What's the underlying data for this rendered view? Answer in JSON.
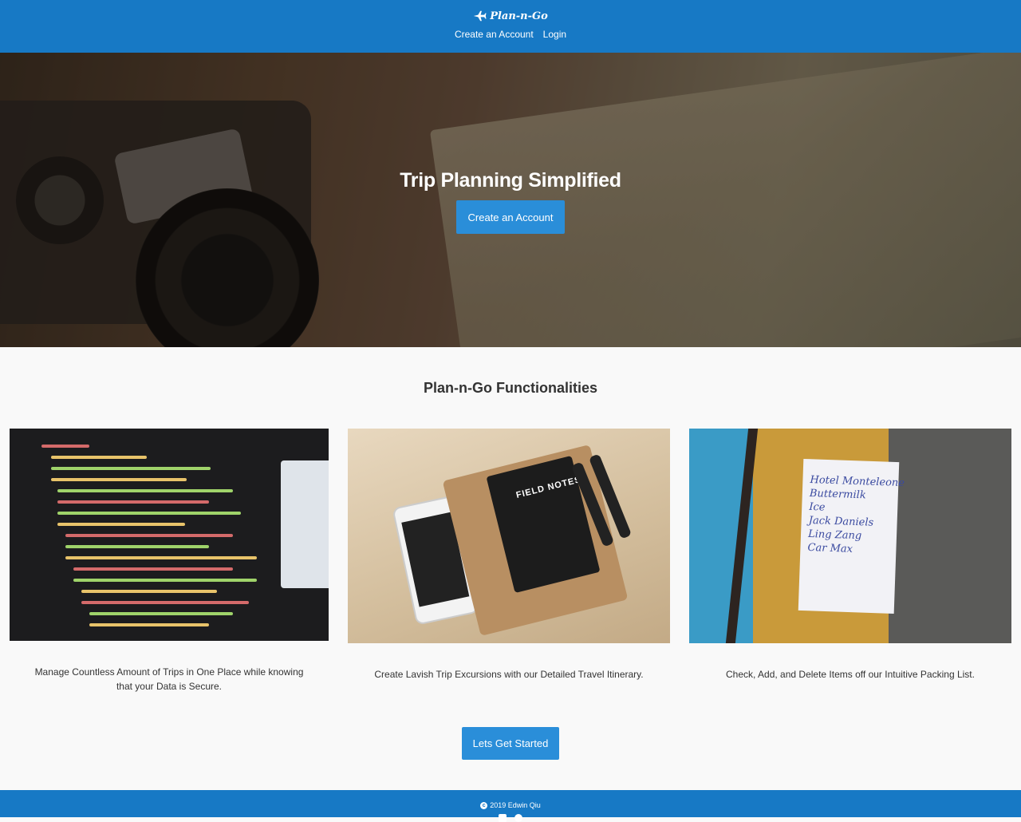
{
  "navbar": {
    "brand": "Plan-n-Go",
    "brand_icon": "airplane-icon",
    "links": [
      {
        "label": "Create an Account"
      },
      {
        "label": "Login"
      }
    ],
    "color": "#1779c5"
  },
  "hero": {
    "title": "Trip Planning Simplified",
    "cta_label": "Create an Account",
    "cta_color": "#2a8ed9"
  },
  "features": {
    "title": "Plan-n-Go Functionalities",
    "cards": [
      {
        "image": "code-editor-photo",
        "text": "Manage Countless Amount of Trips in One Place while knowing that your Data is Secure."
      },
      {
        "image": "field-notes-notebook-photo",
        "text": "Create Lavish Trip Excursions with our Detailed Travel Itinerary.",
        "notebook_label": "FIELD NOTES"
      },
      {
        "image": "handwritten-list-photo",
        "text": "Check, Add, and Delete Items off our Intuitive Packing List.",
        "note_lines": "Hotel Monteleone\nButtermilk\nIce\nJack Daniels\nLing Zang\nCar Max"
      }
    ]
  },
  "start_button": {
    "label": "Lets Get Started"
  },
  "footer": {
    "copyright": "2019 Edwin Qiu",
    "copyright_icon": "copyright-icon",
    "social_icons": [
      "social-icon-1",
      "social-icon-2"
    ]
  }
}
